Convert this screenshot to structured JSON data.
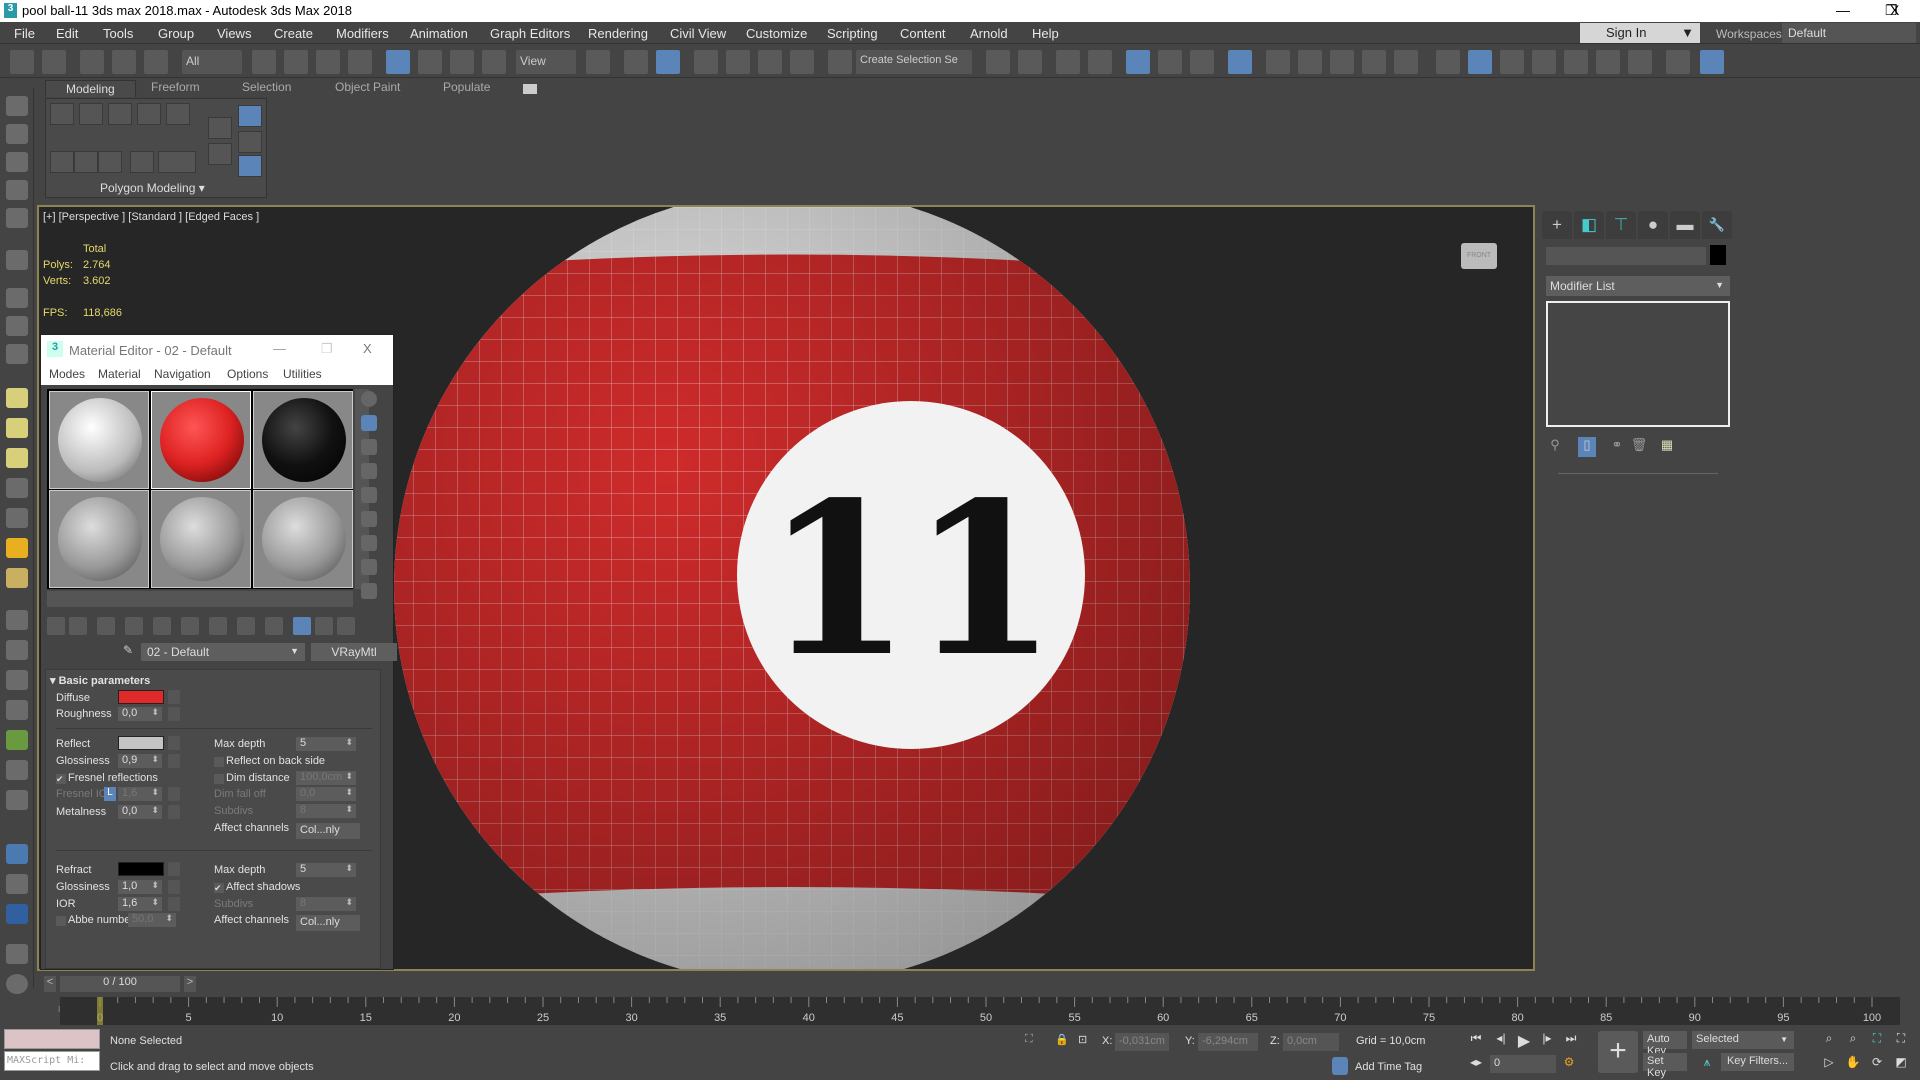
{
  "window": {
    "title": "pool ball-11 3ds max 2018.max - Autodesk 3ds Max 2018",
    "app_icon": "3",
    "minimize": "—",
    "maximize": "❐",
    "close": "X"
  },
  "menu": [
    "File",
    "Edit",
    "Tools",
    "Group",
    "Views",
    "Create",
    "Modifiers",
    "Animation",
    "Graph Editors",
    "Rendering",
    "Civil View",
    "Customize",
    "Scripting",
    "Content",
    "Arnold",
    "Help"
  ],
  "signin": {
    "label": "Sign In",
    "arrow": "▼"
  },
  "workspaces": {
    "label": "Workspaces:",
    "value": "Default"
  },
  "toolbar": {
    "filter": "All",
    "coord": "View",
    "selection_set": "Create Selection Se"
  },
  "ribbon": {
    "tabs": [
      "Modeling",
      "Freeform",
      "Selection",
      "Object Paint",
      "Populate"
    ],
    "panel_label": "Polygon Modeling ▾"
  },
  "viewport": {
    "label": "[+] [Perspective ] [Standard ] [Edged Faces ]",
    "stats": {
      "header": "Total",
      "polys_label": "Polys:",
      "polys": "2.764",
      "verts_label": "Verts:",
      "verts": "3.602",
      "fps_label": "FPS:",
      "fps": "118,686"
    },
    "ball_number": "11",
    "viewcube": "FRONT",
    "colors": {
      "ball": "#d32b2b",
      "stripe": "#ececec"
    }
  },
  "command_panel": {
    "tabs": [
      "+",
      "◧",
      "⊤",
      "●",
      "▬",
      "🔧"
    ],
    "modifier_list": "Modifier List"
  },
  "material_editor": {
    "title": "Material Editor - 02 - Default",
    "menu": [
      "Modes",
      "Material",
      "Navigation",
      "Options",
      "Utilities"
    ],
    "material_name": "02 - Default",
    "material_type": "VRayMtl",
    "rollout": "Basic parameters",
    "diffuse": {
      "label": "Diffuse",
      "color": "#e02a2a"
    },
    "roughness": {
      "label": "Roughness",
      "value": "0,0"
    },
    "reflect": {
      "label": "Reflect",
      "color": "#c4c4c4"
    },
    "refl_glossiness": {
      "label": "Glossiness",
      "value": "0,9"
    },
    "fresnel": {
      "label": "Fresnel reflections",
      "checked": "✔"
    },
    "fresnel_ior": {
      "label": "Fresnel IOR",
      "lock": "L",
      "value": "1,6"
    },
    "metalness": {
      "label": "Metalness",
      "value": "0,0"
    },
    "refl_max_depth": {
      "label": "Max depth",
      "value": "5"
    },
    "reflect_back": {
      "label": "Reflect on back side"
    },
    "dim_distance": {
      "label": "Dim distance",
      "value": "100,0cm"
    },
    "dim_falloff": {
      "label": "Dim fall off",
      "value": "0,0"
    },
    "refl_subdivs": {
      "label": "Subdivs",
      "value": "8"
    },
    "refl_affect": {
      "label": "Affect channels",
      "value": "Col...nly"
    },
    "refract": {
      "label": "Refract",
      "color": "#000000"
    },
    "refr_glossiness": {
      "label": "Glossiness",
      "value": "1,0"
    },
    "ior": {
      "label": "IOR",
      "value": "1,6"
    },
    "abbe": {
      "label": "Abbe number",
      "value": "50,0"
    },
    "refr_max_depth": {
      "label": "Max depth",
      "value": "5"
    },
    "affect_shadows": {
      "label": "Affect shadows",
      "checked": "✔"
    },
    "refr_subdivs": {
      "label": "Subdivs",
      "value": "8"
    },
    "refr_affect": {
      "label": "Affect channels",
      "value": "Col...nly"
    }
  },
  "timeline": {
    "frame": "0 / 100",
    "prev": "<",
    "next": ">",
    "start": 0,
    "end": 100,
    "current": 0
  },
  "status": {
    "maxscript": "MAXScript Mi:",
    "selection": "None Selected",
    "prompt": "Click and drag to select and move objects",
    "x_label": "X:",
    "x": "-0,031cm",
    "y_label": "Y:",
    "y": "-6,294cm",
    "z_label": "Z:",
    "z": "0,0cm",
    "grid": "Grid = 10,0cm",
    "add_time_tag": "Add Time Tag",
    "auto_key": "Auto Key",
    "set_key": "Set Key",
    "key_mode": "Selected",
    "key_filters": "Key Filters...",
    "frame": "0"
  }
}
